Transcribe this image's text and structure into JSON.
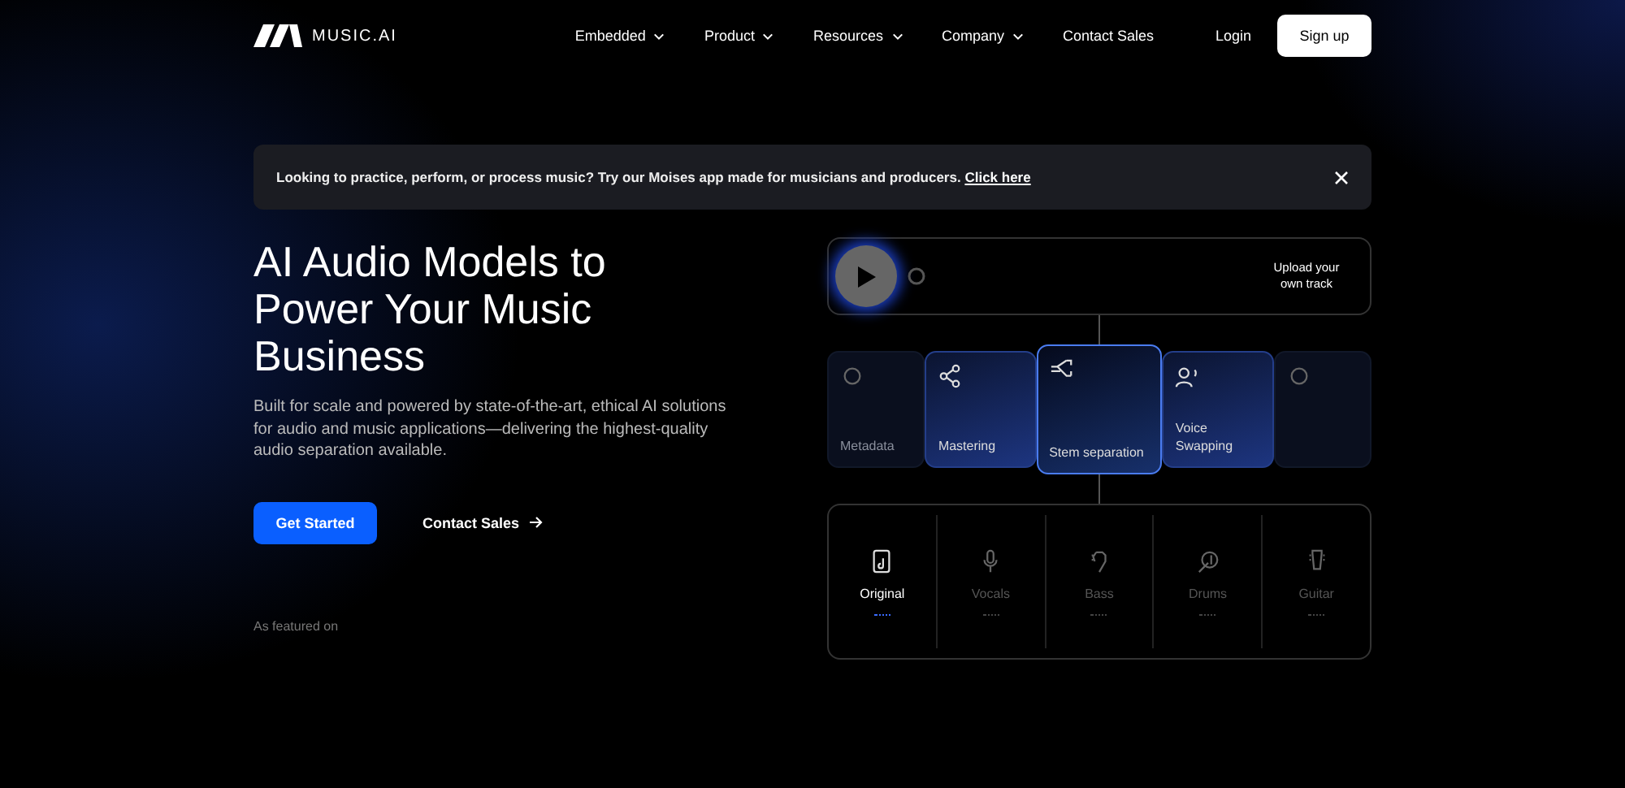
{
  "brand": {
    "name": "MUSIC.AI"
  },
  "nav": {
    "items": [
      {
        "label": "Embedded",
        "dropdown": true
      },
      {
        "label": "Product",
        "dropdown": true
      },
      {
        "label": "Resources",
        "dropdown": true
      },
      {
        "label": "Company",
        "dropdown": true
      },
      {
        "label": "Contact Sales",
        "dropdown": false
      }
    ],
    "login": "Login",
    "signup": "Sign up"
  },
  "banner": {
    "text": "Looking to practice, perform, or process music? Try our Moises app made for musicians and producers.",
    "link": "Click here"
  },
  "hero": {
    "title": "AI Audio Models to Power Your Music Business",
    "subtitle": "Built for scale and powered by state-of-the-art, ethical AI solutions for audio and music applications—delivering the highest-quality audio separation available.",
    "primary": "Get Started",
    "secondary": "Contact Sales"
  },
  "player": {
    "upload": "Upload your own track"
  },
  "models": [
    {
      "label": "Metadata",
      "selected": false,
      "faded": true
    },
    {
      "label": "Mastering",
      "selected": false,
      "faded": false
    },
    {
      "label": "Stem separation",
      "selected": true,
      "faded": false
    },
    {
      "label": "Voice Swapping",
      "selected": false,
      "faded": false
    },
    {
      "selected": false,
      "faded": true
    }
  ],
  "stems": [
    {
      "label": "Original",
      "selected": true
    },
    {
      "label": "Vocals",
      "selected": false
    },
    {
      "label": "Bass",
      "selected": false
    },
    {
      "label": "Drums",
      "selected": false
    },
    {
      "label": "Guitar",
      "selected": false
    }
  ],
  "featured": {
    "label": "As featured on"
  }
}
